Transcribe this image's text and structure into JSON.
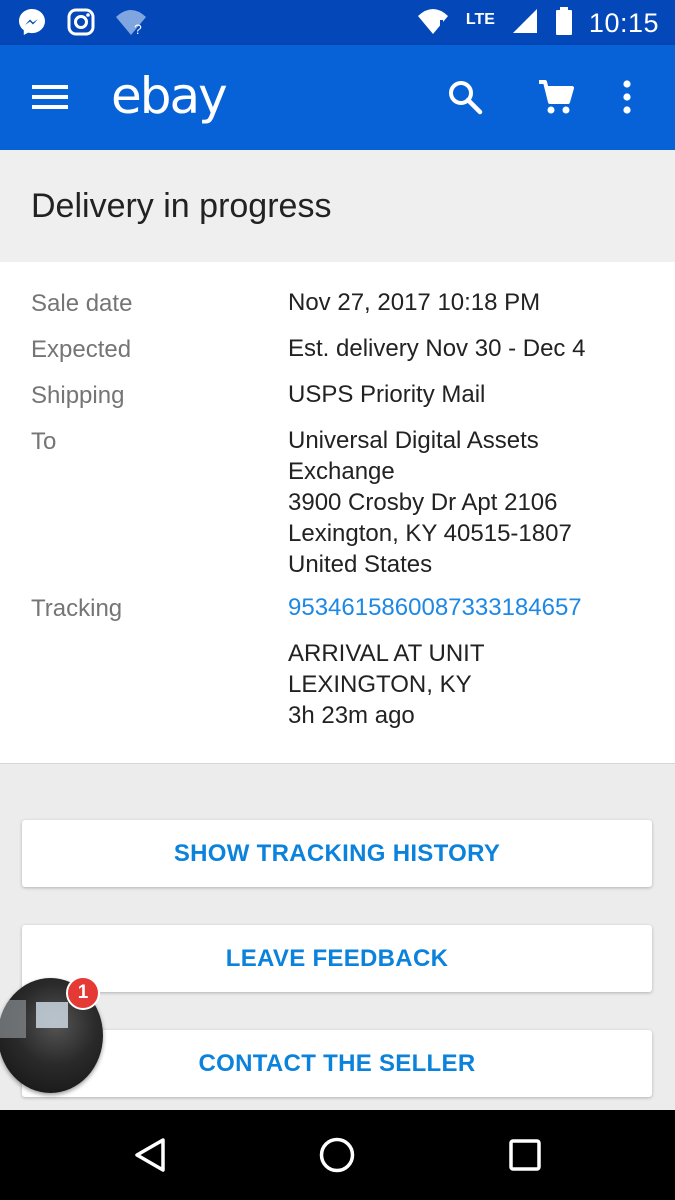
{
  "status_bar": {
    "time": "10:15",
    "network": "LTE",
    "icons": [
      "messenger-icon",
      "instagram-icon",
      "wifi-unknown-icon",
      "wifi-icon",
      "signal-icon",
      "battery-icon"
    ]
  },
  "app_bar": {
    "logo": "ebay",
    "icons": [
      "menu-icon",
      "search-icon",
      "cart-icon",
      "more-vert-icon"
    ]
  },
  "page": {
    "title": "Delivery in progress"
  },
  "details": {
    "sale_date_label": "Sale date",
    "sale_date_value": "Nov 27, 2017 10:18 PM",
    "expected_label": "Expected",
    "expected_value": "Est. delivery Nov 30 - Dec 4",
    "shipping_label": "Shipping",
    "shipping_value": "USPS Priority Mail",
    "to_label": "To",
    "address_lines": [
      "Universal Digital  Assets",
      "Exchange",
      "3900 Crosby Dr Apt 2106",
      "Lexington, KY 40515-1807",
      "United States"
    ],
    "tracking_label": "Tracking",
    "tracking_number": "9534615860087333184657",
    "tracking_status_lines": [
      "ARRIVAL AT UNIT",
      "LEXINGTON, KY",
      "3h 23m ago"
    ]
  },
  "actions": {
    "show_tracking": "SHOW TRACKING HISTORY",
    "leave_feedback": "LEAVE FEEDBACK",
    "contact_seller": "CONTACT THE SELLER"
  },
  "chat_head": {
    "badge_count": "1"
  },
  "colors": {
    "status_bar": "#0447b8",
    "app_bar": "#0862d7",
    "link": "#1e88e5",
    "button_text": "#0b82db"
  }
}
